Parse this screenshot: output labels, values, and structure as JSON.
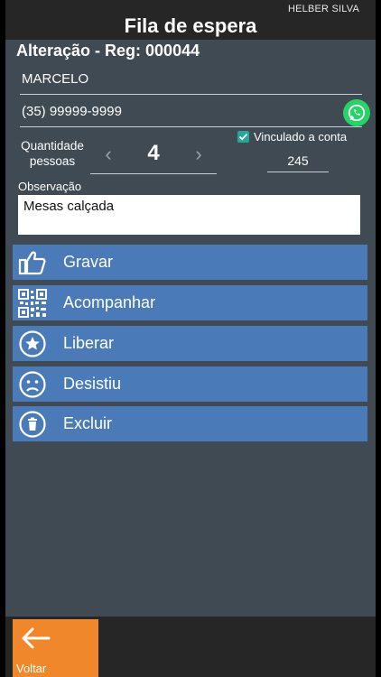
{
  "header": {
    "user": "HELBER SILVA",
    "title": "Fila de espera"
  },
  "record": {
    "heading": "Alteração - Reg: 000044"
  },
  "form": {
    "name": "MARCELO",
    "phone": "(35) 99999-9999",
    "quantity_label_1": "Quantidade",
    "quantity_label_2": "pessoas",
    "quantity": "4",
    "linked_label": "Vinculado a conta",
    "linked_checked": true,
    "account_number": "245",
    "observation_label": "Observação",
    "observation": "Mesas calçada"
  },
  "actions": [
    {
      "label": "Gravar",
      "icon": "thumbs-up-icon"
    },
    {
      "label": "Acompanhar",
      "icon": "qr-code-icon"
    },
    {
      "label": "Liberar",
      "icon": "star-circle-icon"
    },
    {
      "label": "Desistiu",
      "icon": "sad-face-icon"
    },
    {
      "label": "Excluir",
      "icon": "trash-icon"
    }
  ],
  "footer": {
    "back_label": "Voltar"
  },
  "colors": {
    "background": "#3f4a52",
    "bar": "#262626",
    "button": "#4a7ab8",
    "back": "#f0872a",
    "check": "#26a69a",
    "whatsapp": "#25d366"
  }
}
